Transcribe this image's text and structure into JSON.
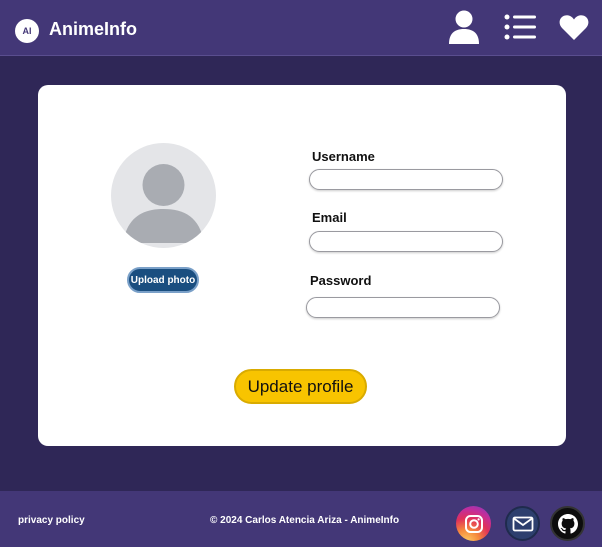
{
  "header": {
    "logo_text": "AI",
    "brand": "AnimeInfo",
    "icons": [
      "user-icon",
      "list-icon",
      "heart-icon"
    ]
  },
  "profile": {
    "upload_label": "Upload photo",
    "fields": [
      {
        "label": "Username",
        "value": ""
      },
      {
        "label": "Email",
        "value": ""
      },
      {
        "label": "Password",
        "value": ""
      }
    ],
    "submit_label": "Update profile"
  },
  "footer": {
    "privacy": "privacy policy",
    "copyright": "© 2024 Carlos Atencia Ariza - AnimeInfo",
    "socials": [
      "instagram-icon",
      "mail-icon",
      "github-icon"
    ]
  },
  "colors": {
    "page_bg": "#2f2757",
    "header_bg": "#433777",
    "upload_btn": "#1a4e80",
    "update_btn": "#f8c400"
  }
}
